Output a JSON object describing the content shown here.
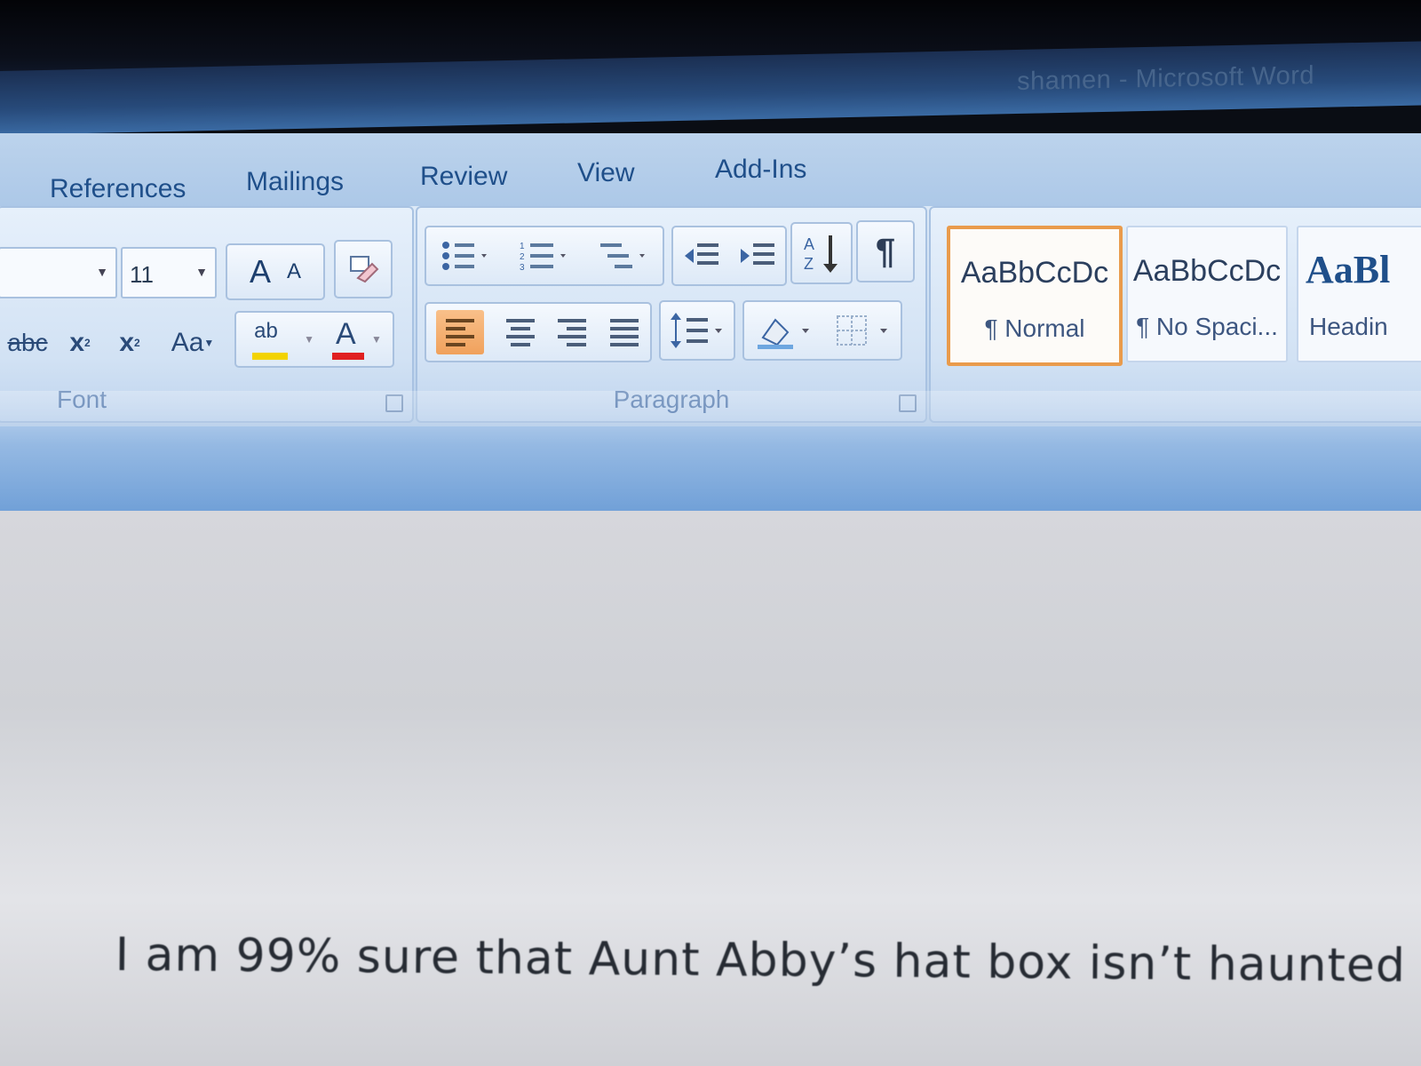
{
  "window": {
    "title": "shamen - Microsoft Word"
  },
  "tabs": [
    "References",
    "Mailings",
    "Review",
    "View",
    "Add-Ins"
  ],
  "font_group": {
    "label": "Font",
    "font_size": "11",
    "grow_font": "A",
    "shrink_font": "A",
    "strikethrough": "abc",
    "subscript": "x",
    "superscript": "x",
    "change_case": "Aa",
    "highlight": "ab",
    "font_color": "A"
  },
  "paragraph_group": {
    "label": "Paragraph",
    "pilcrow": "¶"
  },
  "styles": [
    {
      "sample": "AaBbCcDc",
      "name": "¶ Normal"
    },
    {
      "sample": "AaBbCcDc",
      "name": "¶ No Spaci..."
    },
    {
      "sample": "AaBl",
      "name": "Headin"
    }
  ],
  "document": {
    "text": "I am 99% sure that Aunt Abby’s hat box isn’t haunted"
  }
}
